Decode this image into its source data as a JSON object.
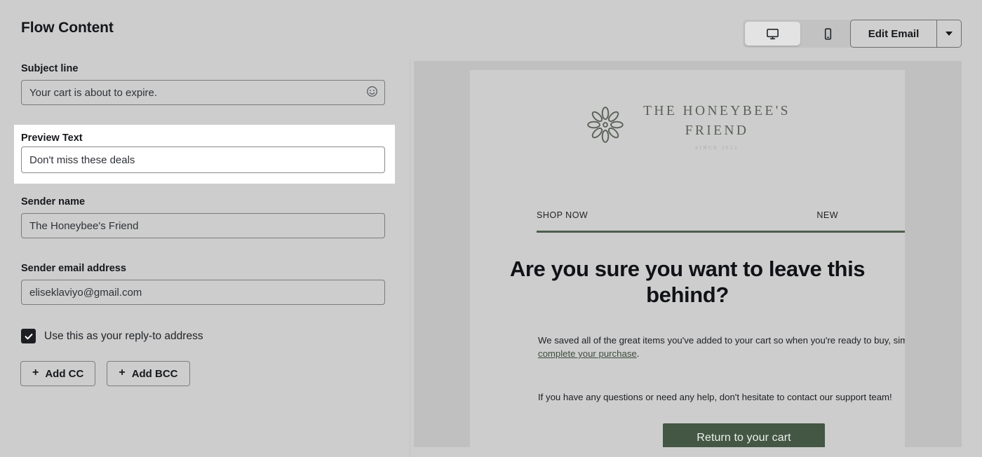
{
  "header": {
    "title": "Flow Content",
    "device_toggle": {
      "desktop_label": "desktop-view",
      "mobile_label": "mobile-view",
      "selected": "desktop"
    },
    "edit_email_label": "Edit Email",
    "edit_email_caret_label": "more-options"
  },
  "form": {
    "subject": {
      "label": "Subject line",
      "value": "Your cart is about to expire.",
      "placeholder": "Subject line",
      "emoji_icon": "smiley-face-icon"
    },
    "preview_text": {
      "label": "Preview Text",
      "value": "Don't miss these deals",
      "placeholder": "Preview Text"
    },
    "sender_name": {
      "label": "Sender name",
      "value": "The Honeybee's Friend",
      "placeholder": "Sender name"
    },
    "sender_email": {
      "label": "Sender email address",
      "value": "eliseklaviyo@gmail.com",
      "placeholder": "Sender email address"
    },
    "reply_to": {
      "label": "Use this as your reply-to address",
      "checked": true
    },
    "add_cc_label": "Add CC",
    "add_bcc_label": "Add BCC",
    "plus_glyph": "+"
  },
  "email_preview": {
    "brand": {
      "flower_icon": "flower-logo-icon",
      "name": "THE HONEYBEE'S\nFRIEND",
      "tagline": "SINCE 2022"
    },
    "nav": [
      {
        "label": "SHOP NOW"
      },
      {
        "label": "NEW"
      }
    ],
    "headline": "Are you sure you want to leave this behind?",
    "body_1_before_link": "We saved all of the great items you've added to your cart so when you're ready to buy, simply ",
    "body_1_link": "complete your purchase",
    "body_1_after_link": ".",
    "body_2": "If you have any questions or need any help, don't hesitate to contact our support team!",
    "cta_label": "Return to your cart"
  },
  "colors": {
    "app_background": "#cdcdcd",
    "preview_pane_background": "#c0c0c0",
    "email_canvas_background": "#cdcdcd",
    "brand_green": "#5a6158",
    "divider_green": "#4d5e4d",
    "cta_green": "#435744",
    "highlight_card": "#ffffff"
  }
}
